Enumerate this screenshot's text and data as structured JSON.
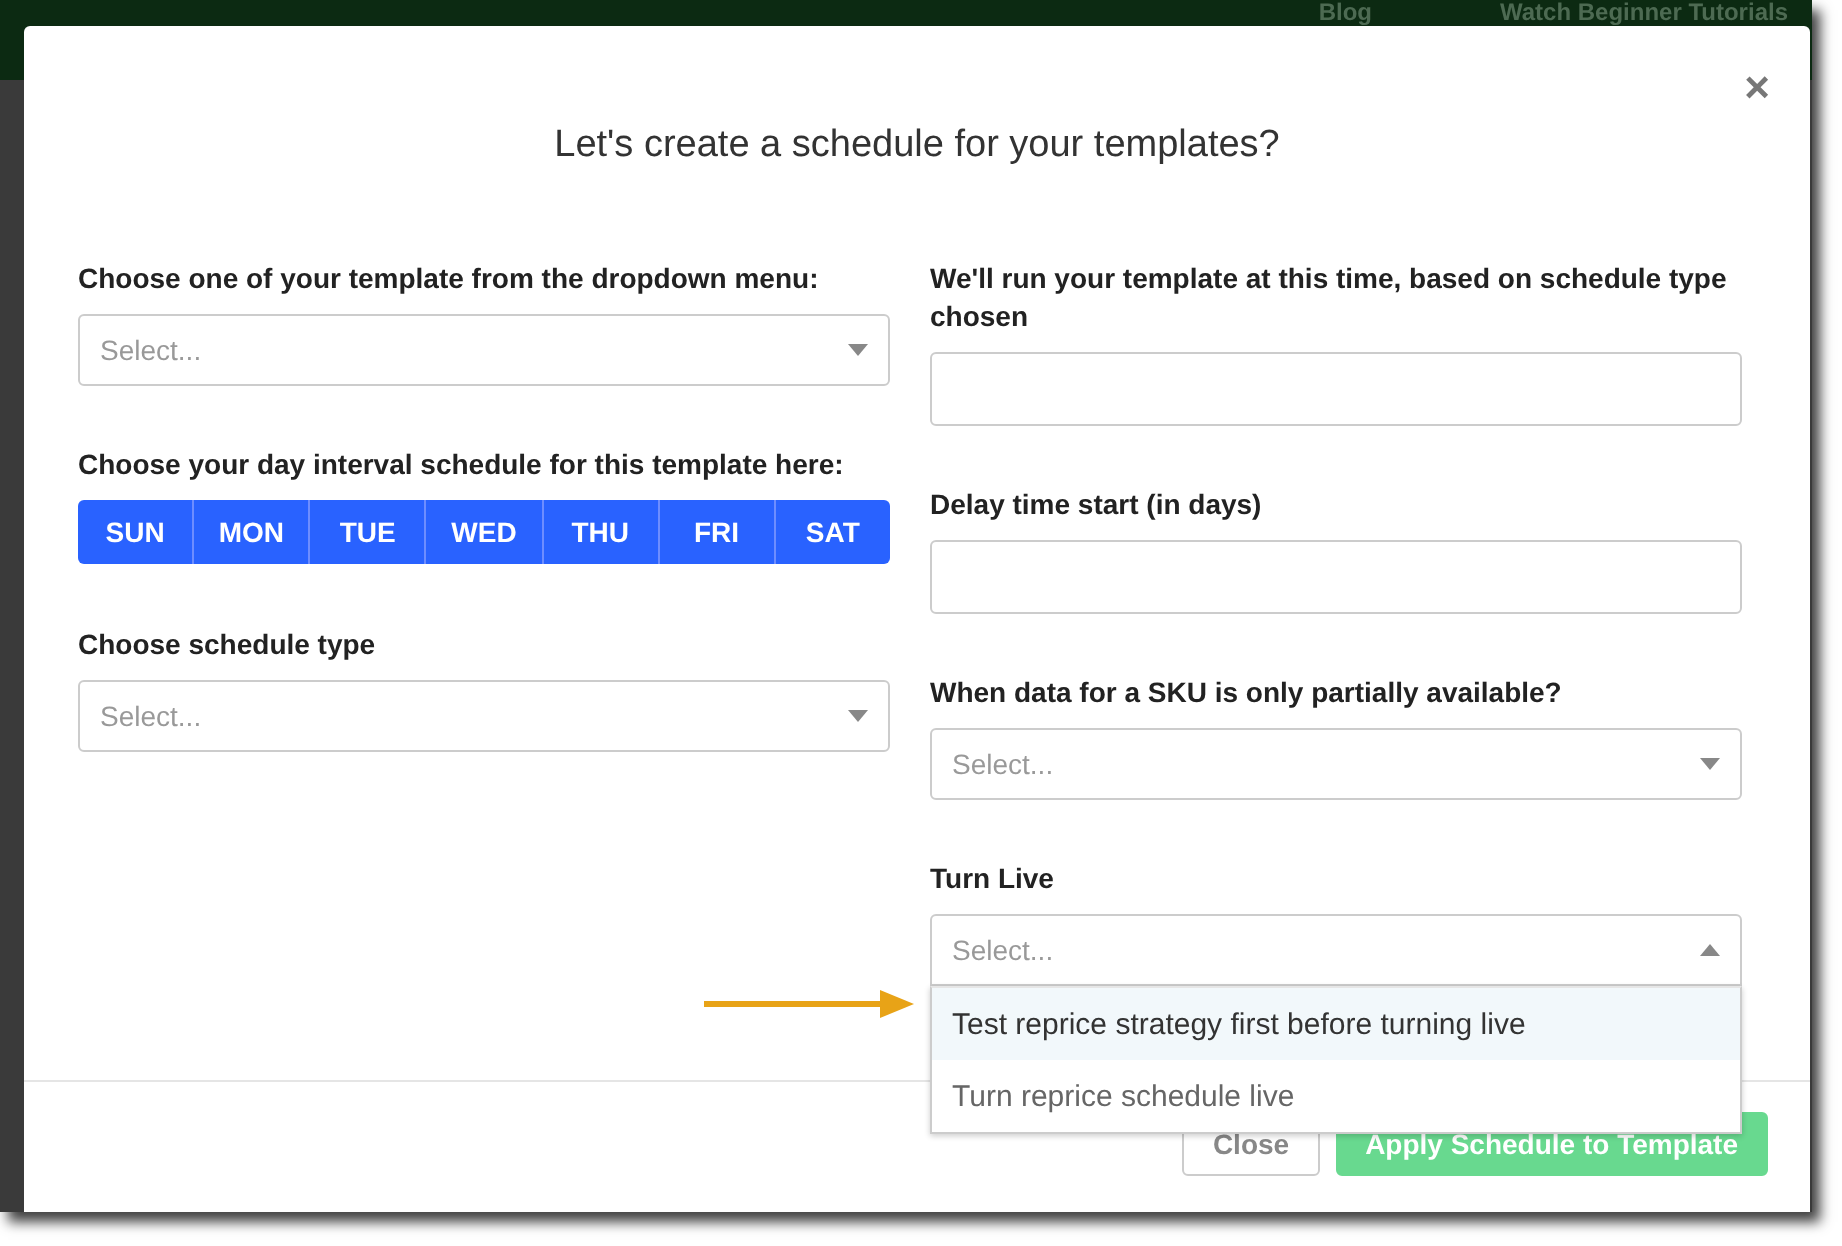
{
  "background_nav": {
    "links": [
      "Blog",
      "Watch Beginner Tutorials"
    ]
  },
  "modal": {
    "close_icon": "×",
    "title": "Let's create a schedule for your templates?",
    "left": {
      "template": {
        "label": "Choose one of your template from the dropdown menu:",
        "placeholder": "Select..."
      },
      "days": {
        "label": "Choose your day interval schedule for this template here:",
        "items": [
          {
            "label": "SUN",
            "selected": true
          },
          {
            "label": "MON",
            "selected": true
          },
          {
            "label": "TUE",
            "selected": true
          },
          {
            "label": "WED",
            "selected": true
          },
          {
            "label": "THU",
            "selected": true
          },
          {
            "label": "FRI",
            "selected": true
          },
          {
            "label": "SAT",
            "selected": true
          }
        ]
      },
      "schedule_type": {
        "label": "Choose schedule type",
        "placeholder": "Select..."
      }
    },
    "right": {
      "run_time": {
        "label": "We'll run your template at this time, based on schedule type chosen"
      },
      "delay": {
        "label": "Delay time start (in days)"
      },
      "partial": {
        "label": "When data for a SKU is only partially available?",
        "placeholder": "Select..."
      },
      "turn_live": {
        "label": "Turn Live",
        "placeholder": "Select...",
        "expanded": true,
        "options": [
          {
            "label": "Test reprice strategy first before turning live",
            "selected": true
          },
          {
            "label": "Turn reprice schedule live",
            "selected": false
          }
        ]
      }
    },
    "buttons": [
      {
        "label": "Close",
        "kind": "secondary"
      },
      {
        "label": "Apply Schedule to Template",
        "kind": "primary"
      }
    ]
  }
}
